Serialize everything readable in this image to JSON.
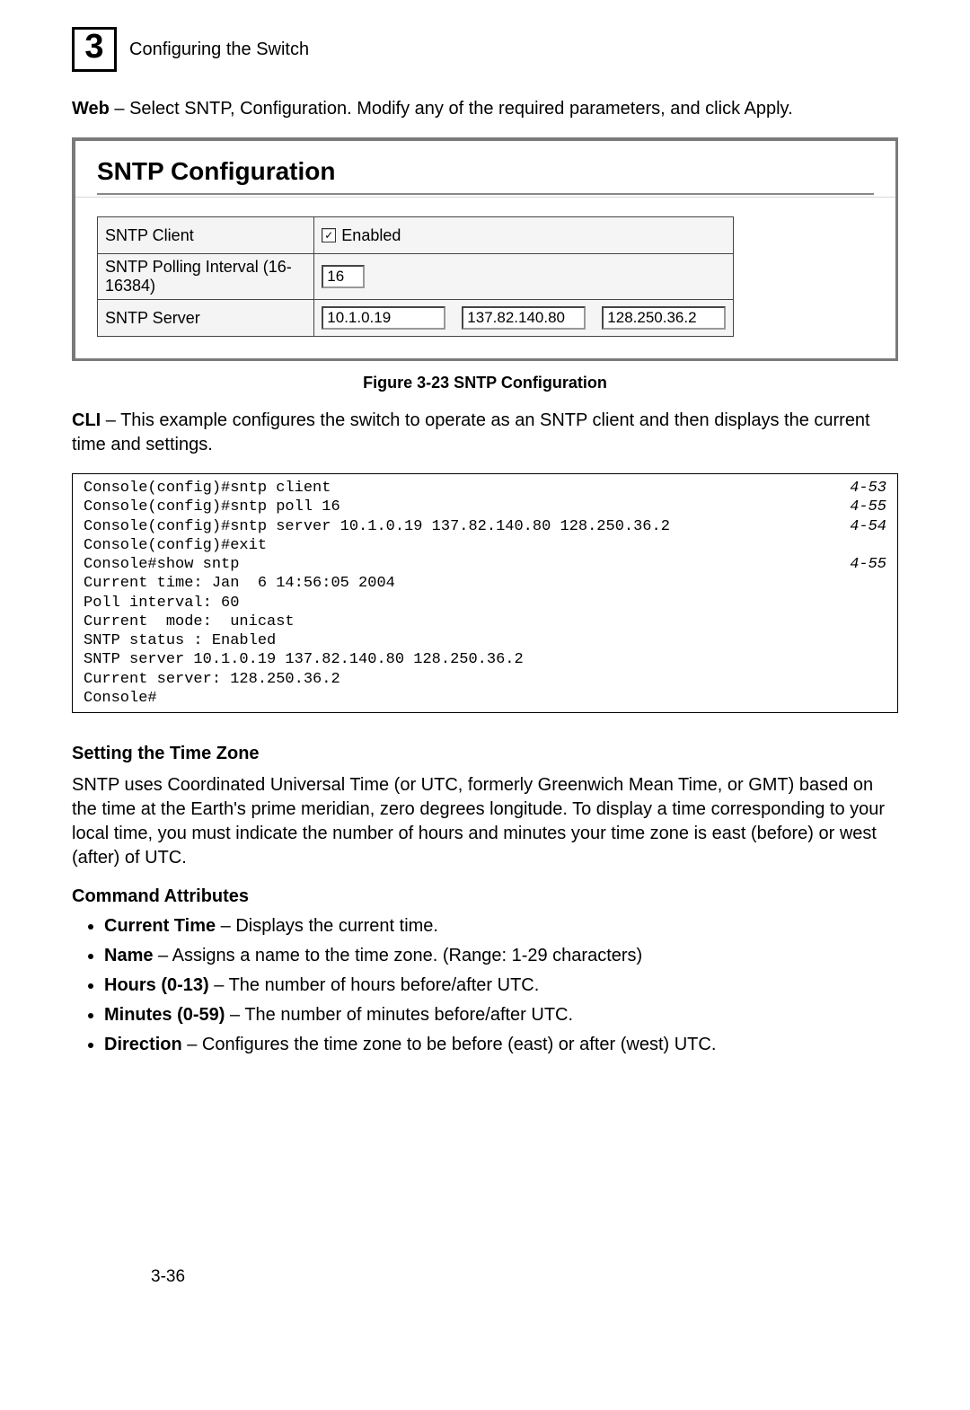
{
  "header": {
    "chapter_number": "3",
    "chapter_title": "Configuring the Switch"
  },
  "web_intro": {
    "label": "Web",
    "text": " – Select SNTP, Configuration. Modify any of the required parameters, and click Apply."
  },
  "screenshot": {
    "title": "SNTP Configuration",
    "rows": {
      "client": {
        "label": "SNTP Client",
        "checkbox_checked": "✓",
        "checkbox_label": "Enabled"
      },
      "poll": {
        "label": "SNTP Polling Interval (16-16384)",
        "value": "16"
      },
      "server": {
        "label": "SNTP Server",
        "v1": "10.1.0.19",
        "v2": "137.82.140.80",
        "v3": "128.250.36.2"
      }
    }
  },
  "figure_caption": "Figure 3-23   SNTP Configuration",
  "cli_intro": {
    "label": "CLI",
    "text": " – This example configures the switch to operate as an SNTP client and then displays the current time and settings."
  },
  "cli_lines": [
    {
      "l": "Console(config)#sntp client",
      "r": "4-53"
    },
    {
      "l": "Console(config)#sntp poll 16",
      "r": "4-55"
    },
    {
      "l": "Console(config)#sntp server 10.1.0.19 137.82.140.80 128.250.36.2",
      "r": "4-54"
    },
    {
      "l": "Console(config)#exit",
      "r": ""
    },
    {
      "l": "Console#show sntp",
      "r": "4-55"
    },
    {
      "l": "Current time: Jan  6 14:56:05 2004",
      "r": ""
    },
    {
      "l": "Poll interval: 60",
      "r": ""
    },
    {
      "l": "Current  mode:  unicast",
      "r": ""
    },
    {
      "l": "SNTP status : Enabled",
      "r": ""
    },
    {
      "l": "SNTP server 10.1.0.19 137.82.140.80 128.250.36.2",
      "r": ""
    },
    {
      "l": "Current server: 128.250.36.2",
      "r": ""
    },
    {
      "l": "Console#",
      "r": ""
    }
  ],
  "timezone": {
    "heading": "Setting the Time Zone",
    "para": "SNTP uses Coordinated Universal Time (or UTC, formerly Greenwich Mean Time, or GMT) based on the time at the Earth's prime meridian, zero degrees longitude. To display a time corresponding to your local time, you must indicate the number of hours and minutes your time zone is east (before) or west (after) of UTC."
  },
  "cmd_attrs": {
    "heading": "Command Attributes",
    "items": [
      {
        "b": "Current Time",
        "t": " – Displays the current time."
      },
      {
        "b": "Name",
        "t": " – Assigns a name to the time zone. (Range: 1-29 characters)"
      },
      {
        "b": "Hours (0-13)",
        "t": " – The number of hours before/after UTC."
      },
      {
        "b": "Minutes (0-59)",
        "t": " – The number of minutes before/after UTC."
      },
      {
        "b": "Direction",
        "t": " – Configures the time zone to be before (east) or after (west) UTC."
      }
    ]
  },
  "page_number": "3-36"
}
